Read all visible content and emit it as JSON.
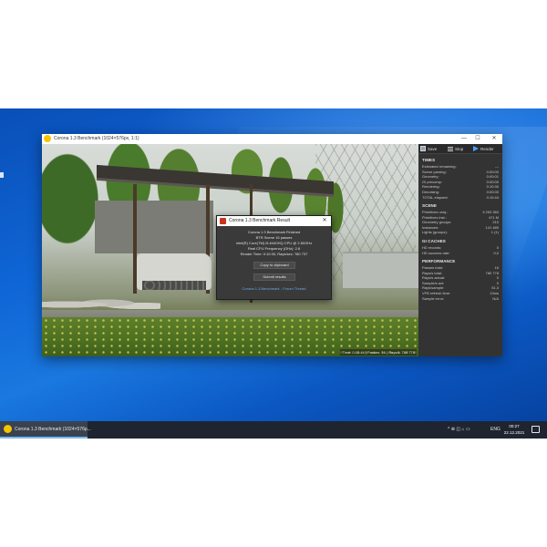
{
  "window": {
    "title": "Corona 1.3 Benchmark (1024×576px, 1:1)",
    "minimize": "—",
    "maximize": "☐",
    "close": "✕"
  },
  "render": {
    "status": "Time: 0:10:44 | Passes: 16 | Rays/s: 780 778"
  },
  "toolbar": {
    "save": "Save",
    "stop": "Stop",
    "render": "Render"
  },
  "panel": {
    "times": {
      "header": "TIMES",
      "rows": [
        {
          "k": "Estimated remaining:",
          "v": "---"
        },
        {
          "k": "Scene parsing:",
          "v": "0:00:00"
        },
        {
          "k": "Geometry:",
          "v": "0:00:01"
        },
        {
          "k": "GI precomp:",
          "v": "0:00:00"
        },
        {
          "k": "Rendering:",
          "v": "0:10:30"
        },
        {
          "k": "Denoising:",
          "v": "0:00:00"
        },
        {
          "k": "TOTAL elapsed:",
          "v": "0:10:44"
        }
      ]
    },
    "scene": {
      "header": "SCENE",
      "rows": [
        {
          "k": "Primitives uniq.:",
          "v": "3 253 360"
        },
        {
          "k": "Primitives inst.:",
          "v": "471 M"
        },
        {
          "k": "Geometry groups:",
          "v": "210"
        },
        {
          "k": "Instances:",
          "v": "141 489"
        },
        {
          "k": "Lights (groups):",
          "v": "1 (1)"
        }
      ]
    },
    "gi_caches": {
      "header": "GI CACHES",
      "rows": [
        {
          "k": "HD records:",
          "v": "0"
        },
        {
          "k": "HD success rate:",
          "v": "0,0"
        }
      ]
    },
    "performance": {
      "header": "PERFORMANCE",
      "rows": [
        {
          "k": "Passes total:",
          "v": "16"
        },
        {
          "k": "Rays/s total:",
          "v": "780 778"
        },
        {
          "k": "Rays/s actual:",
          "v": "0"
        },
        {
          "k": "Sample/s act:",
          "v": "0"
        },
        {
          "k": "Rays/sample:",
          "v": "51,3"
        },
        {
          "k": "VFB refresh time:",
          "v": "13ms"
        },
        {
          "k": "Sample error:",
          "v": "N/A"
        }
      ]
    }
  },
  "dialog": {
    "title": "Corona 1.3 Benchmark Result",
    "close": "✕",
    "lines": [
      "Corona 1.3 Benchmark Finished",
      "BTR Scene 16 passes",
      "Intel(R) Core(TM) i5-6440HQ CPU @ 2.60GHz",
      "Real CPU Frequency (GHz): 2.8",
      "Render Time: 0:10:30, Rays/sec: 780 737"
    ],
    "copy_button": "Copy to clipboard",
    "submit_button": "Submit results",
    "link": "Corona 1.3 Benchmark - Forum Thread"
  },
  "taskbar": {
    "app_label": "Corona 1.3 Benchmark (1024×576p...",
    "tray_icons": "^ ⊕ ◫ ⌂ ▭",
    "lang": "ENG",
    "time": "00:27",
    "date": "22.12.2021"
  }
}
